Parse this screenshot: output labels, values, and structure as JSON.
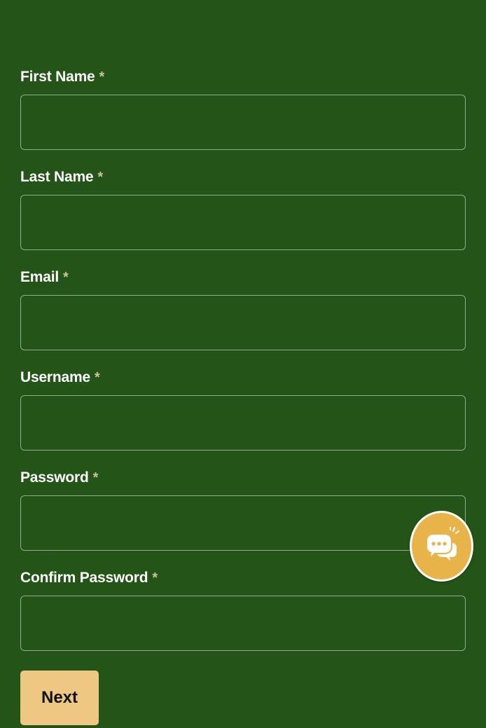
{
  "form": {
    "fields": [
      {
        "label": "First Name",
        "required": "*",
        "value": "",
        "placeholder": ""
      },
      {
        "label": "Last Name",
        "required": "*",
        "value": "",
        "placeholder": ""
      },
      {
        "label": "Email",
        "required": "*",
        "value": "",
        "placeholder": ""
      },
      {
        "label": "Username",
        "required": "*",
        "value": "",
        "placeholder": ""
      },
      {
        "label": "Password",
        "required": "*",
        "value": "",
        "placeholder": ""
      },
      {
        "label": "Confirm Password",
        "required": "*",
        "value": "",
        "placeholder": ""
      }
    ],
    "next_label": "Next"
  },
  "chat_widget": {
    "icon": "chat-bubble-icon"
  },
  "colors": {
    "background": "#245418",
    "input_border": "#93ad8a",
    "button": "#eec883",
    "chat_button": "#e8b44a",
    "required_mark": "#c9c2a0"
  }
}
